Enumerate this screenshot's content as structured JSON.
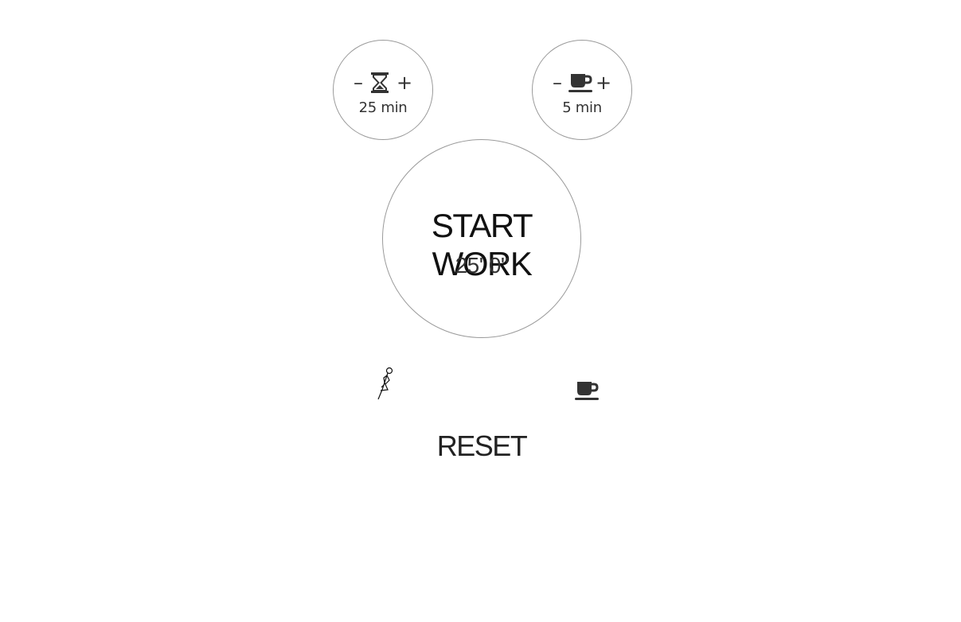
{
  "work_setter": {
    "decrement_label": "–",
    "increment_label": "+",
    "icon": "hourglass-icon",
    "value": "25 min"
  },
  "break_setter": {
    "decrement_label": "–",
    "increment_label": "+",
    "icon": "coffee-cup-icon",
    "value": "5 min"
  },
  "main_timer": {
    "label": "START WORK",
    "time": "25' 0\""
  },
  "status_icons": {
    "work": "walking-figure-icon",
    "break": "coffee-cup-icon"
  },
  "controls": {
    "reset_label": "RESET"
  },
  "colors": {
    "circle_border": "#9a9a9a",
    "text": "#222222",
    "background": "#ffffff"
  }
}
